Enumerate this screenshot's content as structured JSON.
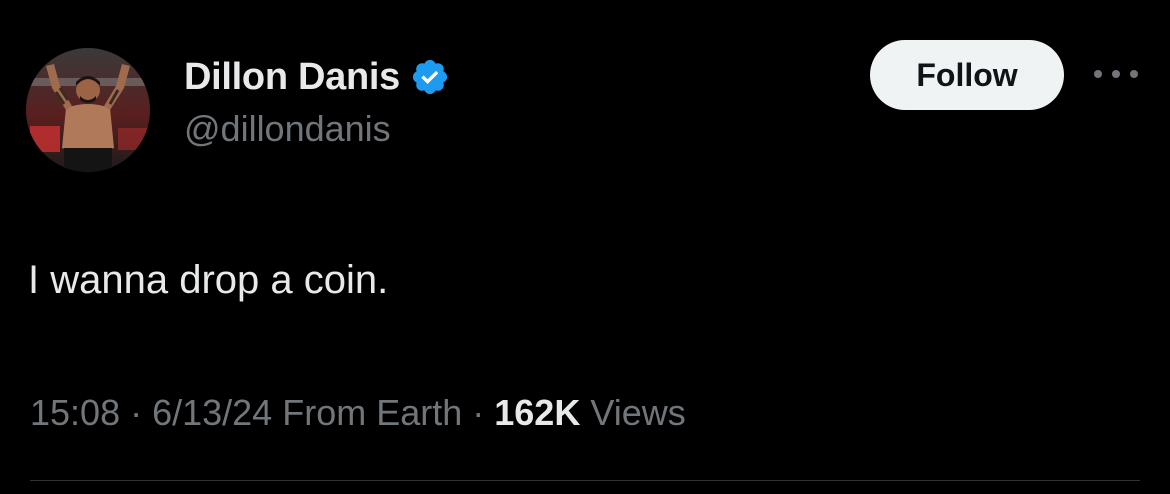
{
  "tweet": {
    "author": {
      "display_name": "Dillon Danis",
      "handle": "@dillondanis",
      "verified": true,
      "verified_icon": "verified-badge-icon",
      "avatar_icon": "profile-avatar"
    },
    "follow_label": "Follow",
    "more_icon": "more-options-icon",
    "text": "I wanna drop a coin.",
    "meta": {
      "time": "15:08",
      "date": "6/13/24",
      "location": "From Earth",
      "views_count": "162K",
      "views_label": "Views",
      "separator": "·"
    }
  },
  "colors": {
    "background": "#000000",
    "primary_text": "#e7e9ea",
    "secondary_text": "#71767b",
    "verified_blue": "#1d9bf0",
    "follow_button_bg": "#eff3f4",
    "follow_button_text": "#0f1419"
  }
}
